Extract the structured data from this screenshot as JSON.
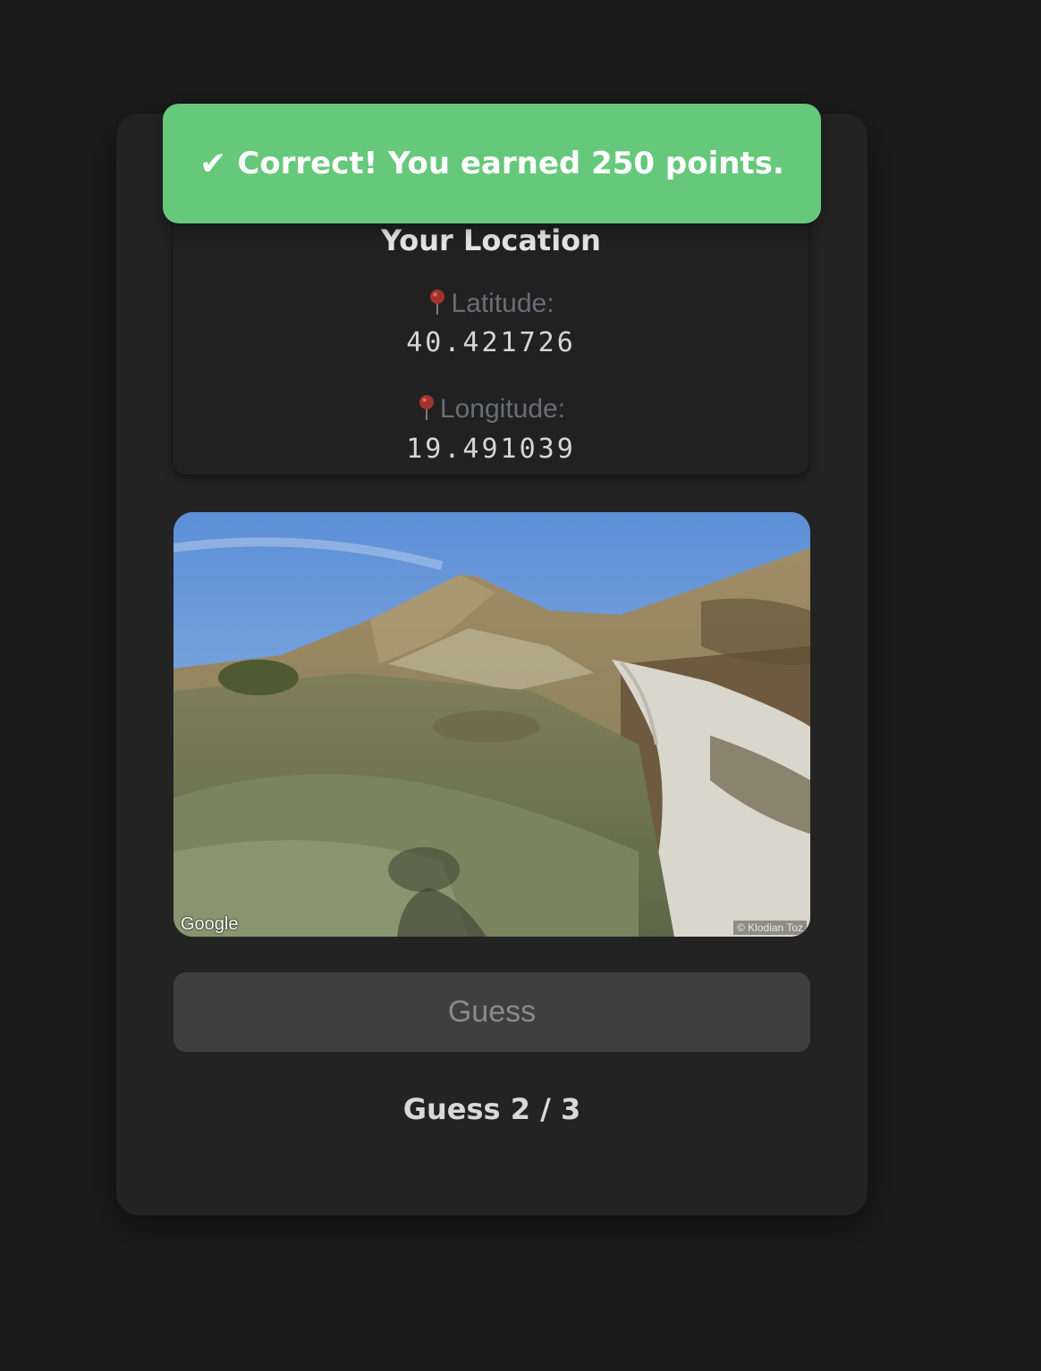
{
  "toast": {
    "check": "✔",
    "message": "Correct! You earned 250 points."
  },
  "location": {
    "title": "Your Location",
    "latitude_label": "Latitude:",
    "latitude_value": "40.421726",
    "longitude_label": "Longitude:",
    "longitude_value": "19.491039",
    "pin_icon": "map-pin-icon"
  },
  "streetview": {
    "provider_logo": "Google",
    "credit": "© Klodian Toz"
  },
  "guess_button": {
    "label": "Guess",
    "enabled": false
  },
  "counter": {
    "text": "Guess 2 / 3"
  },
  "colors": {
    "background": "#1c1c1c",
    "card": "#232323",
    "toast": "#66c87b",
    "pin": "#a6322d",
    "button": "#3f3f3f"
  }
}
